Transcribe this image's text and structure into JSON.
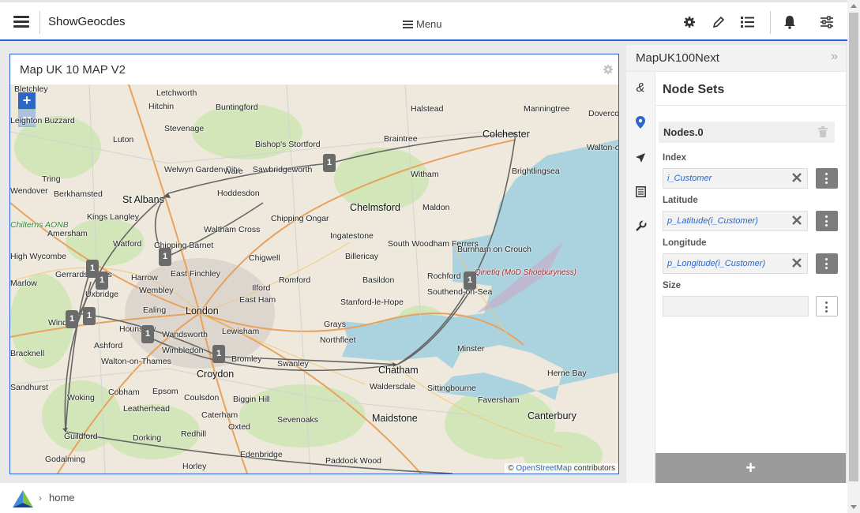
{
  "app": {
    "title": "ShowGeocdes"
  },
  "topbar": {
    "menu_label": "Menu",
    "icons": [
      "gear-icon",
      "pencil-icon",
      "list-icon",
      "bell-icon",
      "sliders-icon"
    ]
  },
  "map_card": {
    "title": "Map UK 10 MAP V2",
    "zoom_in": "+",
    "zoom_out": "−",
    "attribution": {
      "prefix": "©",
      "link": "OpenStreetMap",
      "suffix": "contributors"
    },
    "marker_count": "1",
    "places": [
      "Bletchley",
      "Letchworth",
      "Hitchin",
      "Buntingford",
      "Halstead",
      "Manningtree",
      "Dovercourt",
      "Leighton Buzzard",
      "Stevenage",
      "Luton",
      "Bishop's Stortford",
      "Braintree",
      "Colchester",
      "Walton-on-the-Naze",
      "Welwyn Garden City",
      "Ware",
      "Sawbridgeworth",
      "Witham",
      "Brightlingsea",
      "Tring",
      "Berkhamsted",
      "St Albans",
      "Hoddesdon",
      "Wendover",
      "Kings Langley",
      "Chipping Ongar",
      "Chelmsford",
      "Maldon",
      "Amersham",
      "Waltham Cross",
      "Chilterns AONB",
      "Watford",
      "Chipping Barnet",
      "Ingatestone",
      "South Woodham Ferrers",
      "Burnham on Crouch",
      "High Wycombe",
      "Chigwell",
      "Billericay",
      "Gerrards Cross",
      "Harrow",
      "East Finchley",
      "Qinetiq (MoD Shoeburyness)",
      "Romford",
      "Basildon",
      "Rochford",
      "Marlow",
      "Uxbridge",
      "Wembley",
      "Ilford",
      "East Ham",
      "Stanford-le-Hope",
      "Southend-on-Sea",
      "London",
      "Ealing",
      "Windsor",
      "Hounslow",
      "Grays",
      "Wandsworth",
      "Lewisham",
      "Ashford",
      "Northfleet",
      "Bracknell",
      "Wimbledon",
      "Bromley",
      "Swanley",
      "Minster",
      "Walton-on-Thames",
      "Croydon",
      "Chatham",
      "Herne Bay",
      "Sandhurst",
      "Epsom",
      "Cobham",
      "Waldersdale",
      "Sittingbourne",
      "Woking",
      "Coulsdon",
      "Biggin Hill",
      "Faversham",
      "Leatherhead",
      "Caterham",
      "Maidstone",
      "Canterbury",
      "Oxted",
      "Sevenoaks",
      "Guildford",
      "Dorking",
      "Redhill",
      "Edenbridge",
      "Godalming",
      "Paddock Wood",
      "Horley"
    ]
  },
  "right_panel": {
    "title": "MapUK100Next",
    "collapse": "»",
    "section_title": "Node Sets",
    "node_name": "Nodes.0",
    "fields": [
      {
        "label": "Index",
        "value": "i_Customer"
      },
      {
        "label": "Latitude",
        "value": "p_Latitude(i_Customer)"
      },
      {
        "label": "Longitude",
        "value": "p_Longitude(i_Customer)"
      },
      {
        "label": "Size",
        "value": ""
      }
    ],
    "add_label": "+",
    "side_icons": [
      "ampersand-icon",
      "map-pin-icon",
      "navigation-arrow-icon",
      "document-icon",
      "wrench-icon"
    ]
  },
  "breadcrumb": {
    "separator": "›",
    "current": "home"
  },
  "colors": {
    "accent": "#2962d9",
    "marker": "#6b6b6b",
    "water": "#aad3df"
  }
}
